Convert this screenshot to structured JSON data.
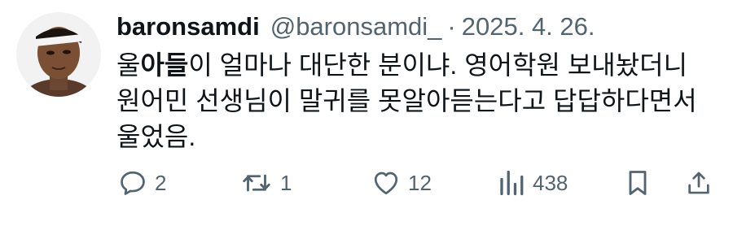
{
  "post": {
    "author_name": "baronsamdi",
    "author_handle": "@baronsamdi_",
    "separator": "·",
    "date": "2025. 4. 26.",
    "text_lines": [
      {
        "parts": [
          {
            "text": "울",
            "bold": false
          },
          {
            "text": "아들",
            "bold": true
          },
          {
            "text": "이 얼마나 대단한 분이냐. 영어학원 보내놨더니",
            "bold": false
          }
        ]
      },
      {
        "parts": [
          {
            "text": "원어민 선생님이 말귀를 못알아듣는다고 답답하다면서",
            "bold": false
          }
        ]
      },
      {
        "parts": [
          {
            "text": "울었음.",
            "bold": false
          }
        ]
      }
    ]
  },
  "actions": {
    "reply_count": "2",
    "retweet_count": "1",
    "like_count": "12",
    "view_count": "438"
  },
  "icons": {
    "reply": "reply-icon",
    "retweet": "retweet-icon",
    "like": "heart-icon",
    "views": "views-icon",
    "bookmark": "bookmark-icon",
    "share": "share-icon"
  },
  "colors": {
    "text_primary": "#0f1419",
    "text_secondary": "#536471"
  }
}
